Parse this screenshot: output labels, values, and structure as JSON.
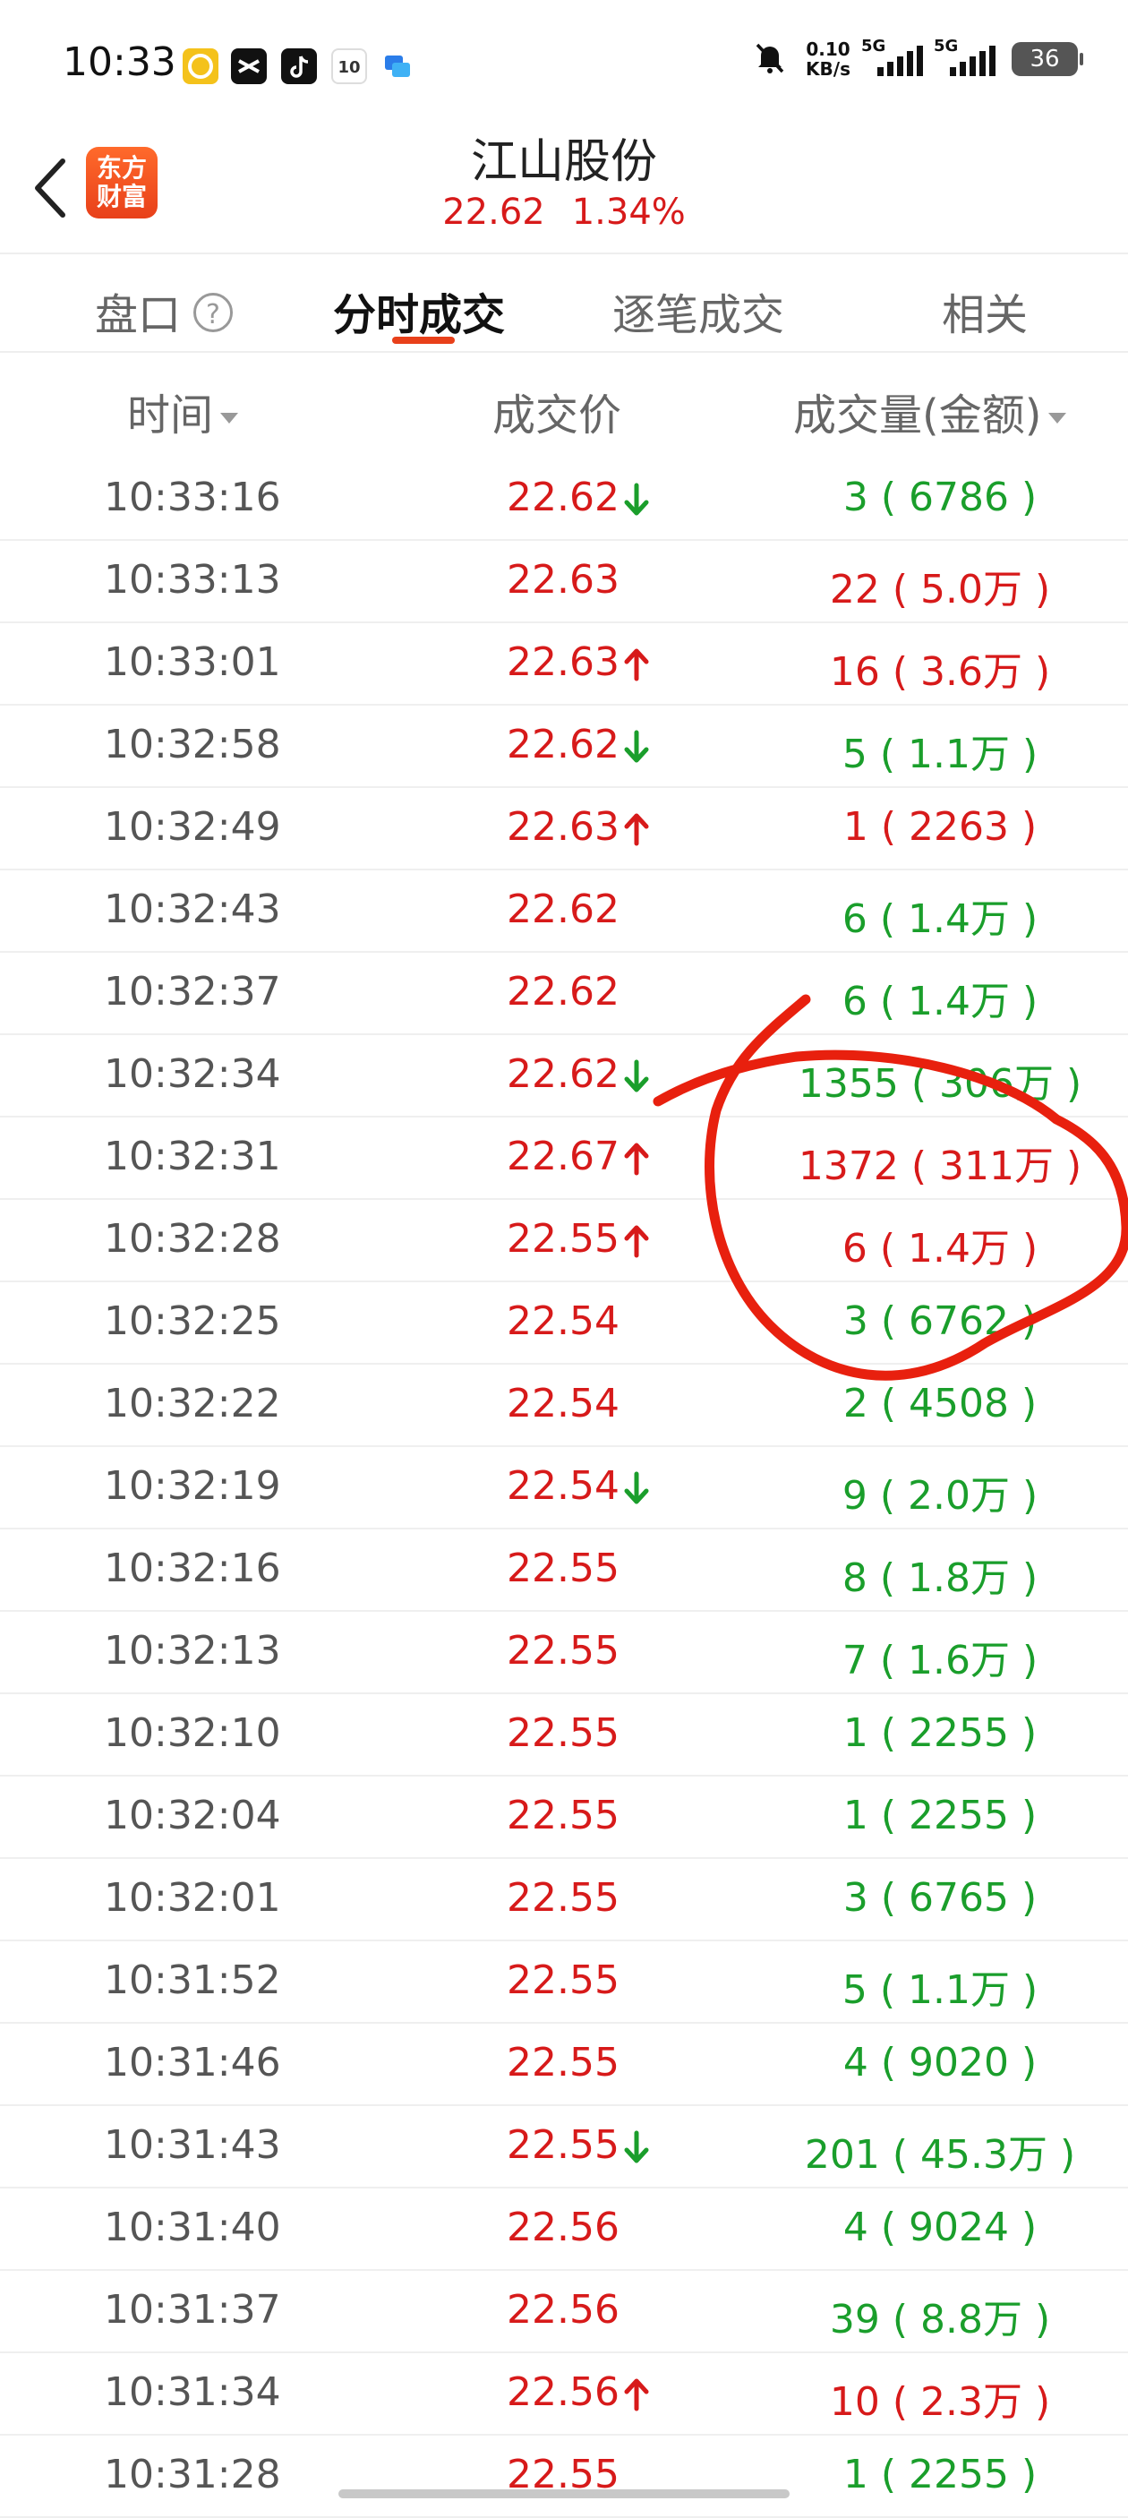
{
  "status_bar": {
    "time": "10:33",
    "net_speed_value": "0.10",
    "net_speed_unit": "KB/s",
    "signal1_tag": "5G",
    "signal2_tag": "5G",
    "battery": "36",
    "app_icons": [
      "coin-app-icon",
      "capcut-icon",
      "tiktok-icon",
      "calendar-10-icon",
      "chat-app-icon"
    ],
    "calendar_day": "10"
  },
  "header": {
    "brand_line1": "东方",
    "brand_line2": "财富",
    "stock_name": "江山股份",
    "price": "22.62",
    "change_pct": "1.34%"
  },
  "tabs": [
    {
      "label": "盘口",
      "active": false
    },
    {
      "label": "分时成交",
      "active": true
    },
    {
      "label": "逐笔成交",
      "active": false
    },
    {
      "label": "相关",
      "active": false
    }
  ],
  "help_glyph": "?",
  "columns": {
    "time": "时间",
    "price": "成交价",
    "volume": "成交量(金额)"
  },
  "colors": {
    "up": "#d71a1a",
    "down": "#1a9e2b",
    "accent": "#e8401a"
  },
  "trades": [
    {
      "time": "10:33:16",
      "price": "22.62",
      "dir": "down",
      "volume": "3 ( 6786 )",
      "side": "sell"
    },
    {
      "time": "10:33:13",
      "price": "22.63",
      "dir": "",
      "volume": "22 ( 5.0万 )",
      "side": "buy"
    },
    {
      "time": "10:33:01",
      "price": "22.63",
      "dir": "up",
      "volume": "16 ( 3.6万 )",
      "side": "buy"
    },
    {
      "time": "10:32:58",
      "price": "22.62",
      "dir": "down",
      "volume": "5 ( 1.1万 )",
      "side": "sell"
    },
    {
      "time": "10:32:49",
      "price": "22.63",
      "dir": "up",
      "volume": "1 ( 2263 )",
      "side": "buy"
    },
    {
      "time": "10:32:43",
      "price": "22.62",
      "dir": "",
      "volume": "6 ( 1.4万 )",
      "side": "sell"
    },
    {
      "time": "10:32:37",
      "price": "22.62",
      "dir": "",
      "volume": "6 ( 1.4万 )",
      "side": "sell"
    },
    {
      "time": "10:32:34",
      "price": "22.62",
      "dir": "down",
      "volume": "1355 ( 306万 )",
      "side": "sell"
    },
    {
      "time": "10:32:31",
      "price": "22.67",
      "dir": "up",
      "volume": "1372 ( 311万 )",
      "side": "buy"
    },
    {
      "time": "10:32:28",
      "price": "22.55",
      "dir": "up",
      "volume": "6 ( 1.4万 )",
      "side": "buy"
    },
    {
      "time": "10:32:25",
      "price": "22.54",
      "dir": "",
      "volume": "3 ( 6762 )",
      "side": "sell"
    },
    {
      "time": "10:32:22",
      "price": "22.54",
      "dir": "",
      "volume": "2 ( 4508 )",
      "side": "sell"
    },
    {
      "time": "10:32:19",
      "price": "22.54",
      "dir": "down",
      "volume": "9 ( 2.0万 )",
      "side": "sell"
    },
    {
      "time": "10:32:16",
      "price": "22.55",
      "dir": "",
      "volume": "8 ( 1.8万 )",
      "side": "sell"
    },
    {
      "time": "10:32:13",
      "price": "22.55",
      "dir": "",
      "volume": "7 ( 1.6万 )",
      "side": "sell"
    },
    {
      "time": "10:32:10",
      "price": "22.55",
      "dir": "",
      "volume": "1 ( 2255 )",
      "side": "sell"
    },
    {
      "time": "10:32:04",
      "price": "22.55",
      "dir": "",
      "volume": "1 ( 2255 )",
      "side": "sell"
    },
    {
      "time": "10:32:01",
      "price": "22.55",
      "dir": "",
      "volume": "3 ( 6765 )",
      "side": "sell"
    },
    {
      "time": "10:31:52",
      "price": "22.55",
      "dir": "",
      "volume": "5 ( 1.1万 )",
      "side": "sell"
    },
    {
      "time": "10:31:46",
      "price": "22.55",
      "dir": "",
      "volume": "4 ( 9020 )",
      "side": "sell"
    },
    {
      "time": "10:31:43",
      "price": "22.55",
      "dir": "down",
      "volume": "201 ( 45.3万 )",
      "side": "sell"
    },
    {
      "time": "10:31:40",
      "price": "22.56",
      "dir": "",
      "volume": "4 ( 9024 )",
      "side": "sell"
    },
    {
      "time": "10:31:37",
      "price": "22.56",
      "dir": "",
      "volume": "39 ( 8.8万 )",
      "side": "sell"
    },
    {
      "time": "10:31:34",
      "price": "22.56",
      "dir": "up",
      "volume": "10 ( 2.3万 )",
      "side": "buy"
    },
    {
      "time": "10:31:28",
      "price": "22.55",
      "dir": "",
      "volume": "1 ( 2255 )",
      "side": "sell"
    }
  ]
}
